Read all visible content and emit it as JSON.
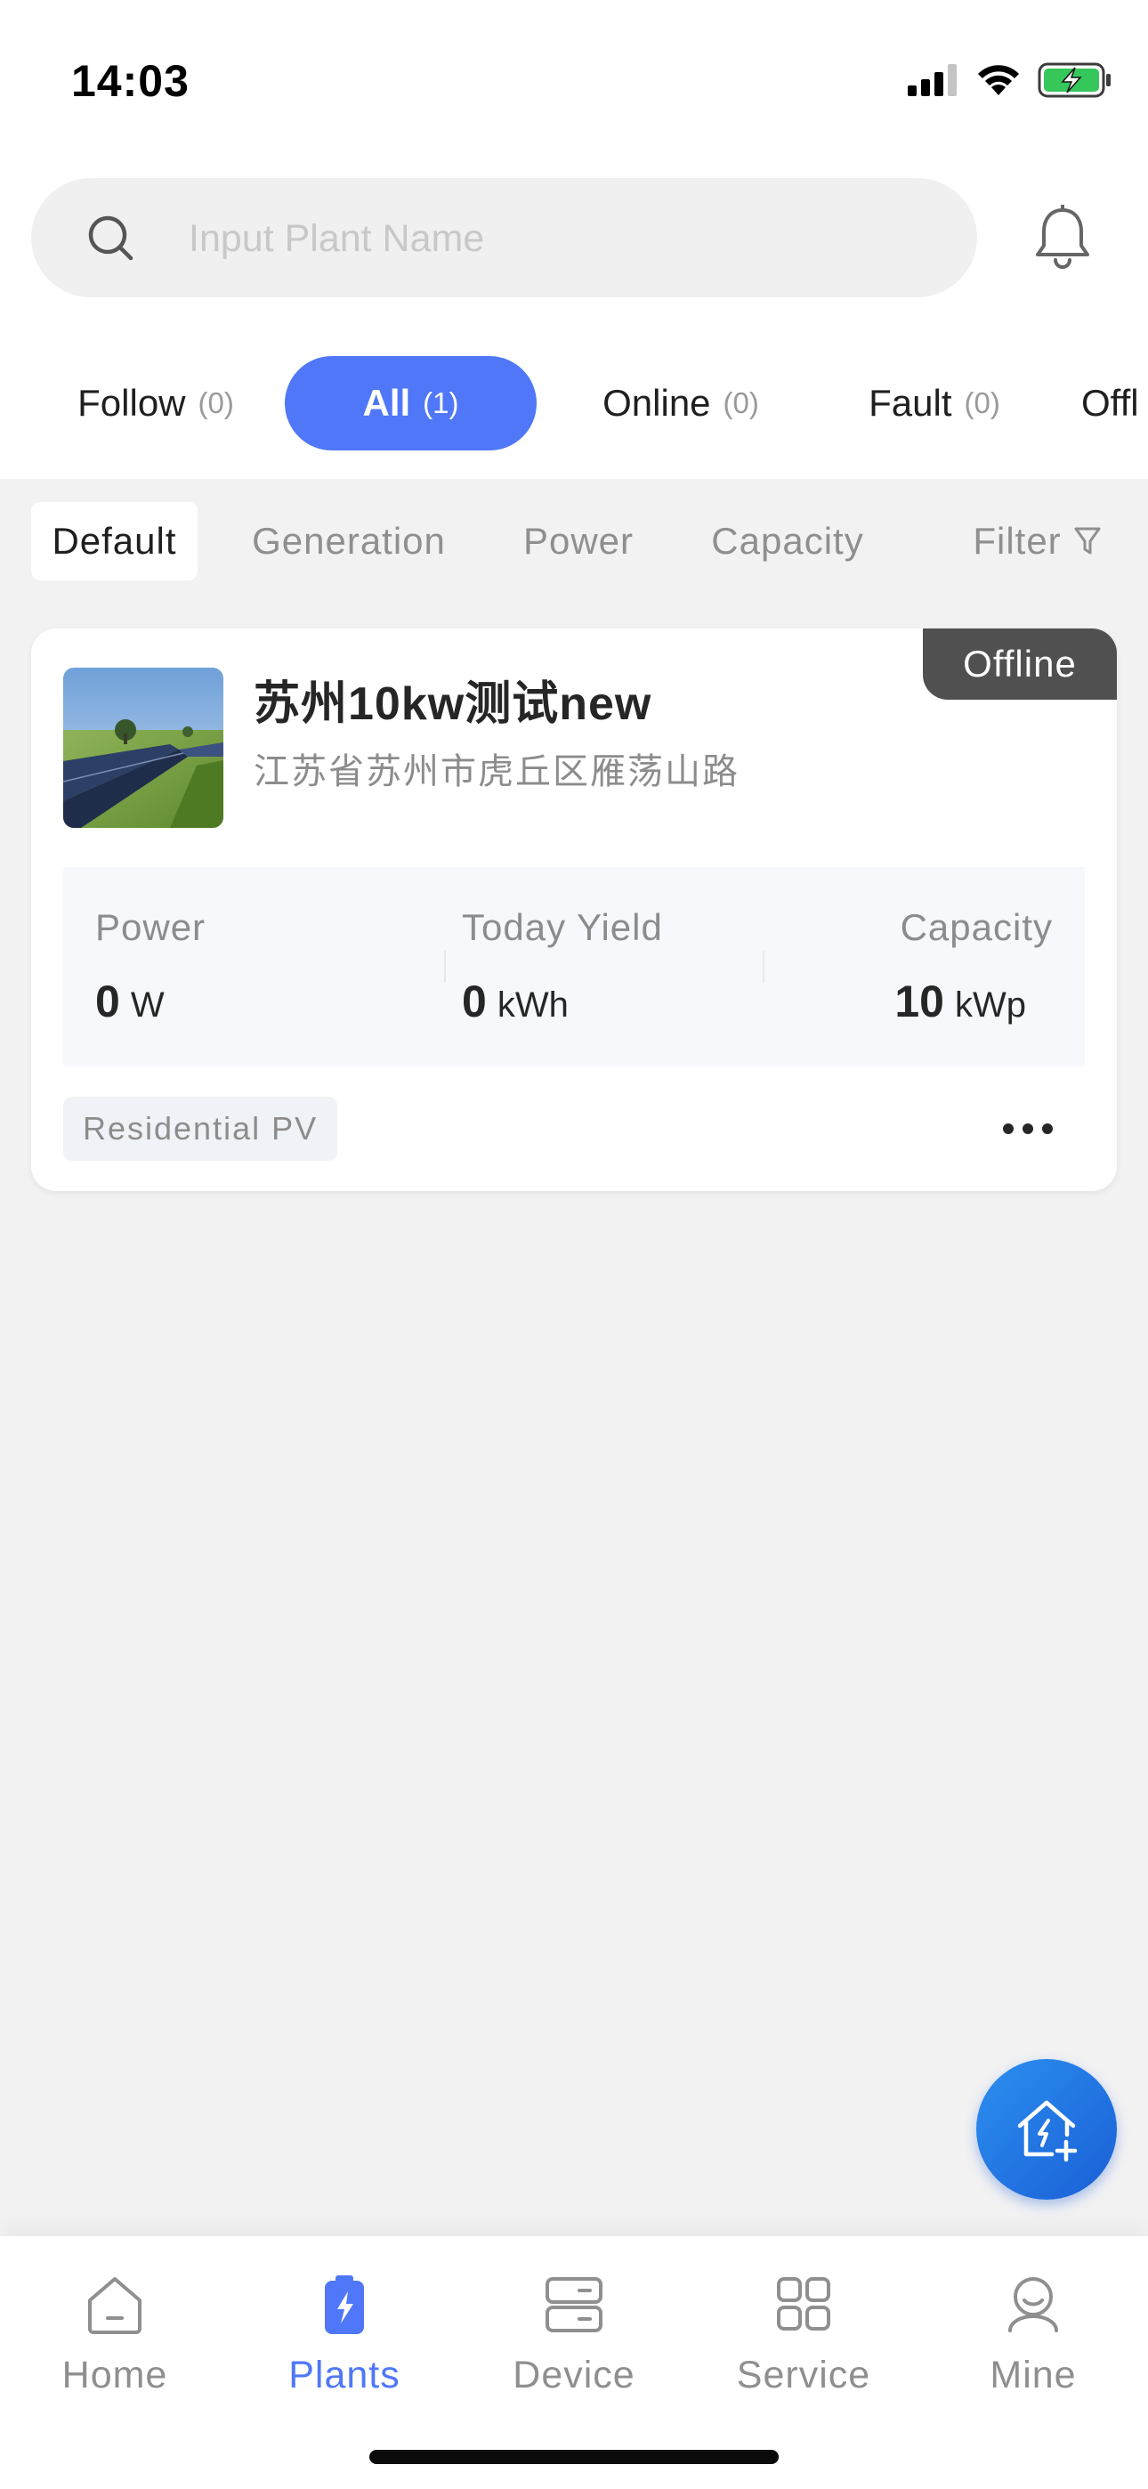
{
  "status_bar": {
    "time": "14:03"
  },
  "search": {
    "placeholder": "Input Plant Name"
  },
  "tabs": [
    {
      "label": "Follow",
      "count": "(0)"
    },
    {
      "label": "All",
      "count": "(1)",
      "active": true
    },
    {
      "label": "Online",
      "count": "(0)"
    },
    {
      "label": "Fault",
      "count": "(0)"
    },
    {
      "label": "Offl"
    }
  ],
  "sort_options": [
    "Default",
    "Generation",
    "Power",
    "Capacity"
  ],
  "sort_active": "Default",
  "filter_label": "Filter",
  "plant": {
    "status": "Offline",
    "name": "苏州10kw测试new",
    "address": "江苏省苏州市虎丘区雁荡山路",
    "stats": [
      {
        "label": "Power",
        "value": "0",
        "unit": "W"
      },
      {
        "label": "Today Yield",
        "value": "0",
        "unit": "kWh"
      },
      {
        "label": "Capacity",
        "value": "10",
        "unit": "kWp"
      }
    ],
    "type": "Residential PV"
  },
  "nav": [
    {
      "label": "Home",
      "icon": "home-icon"
    },
    {
      "label": "Plants",
      "icon": "plants-icon",
      "active": true
    },
    {
      "label": "Device",
      "icon": "device-icon"
    },
    {
      "label": "Service",
      "icon": "service-icon"
    },
    {
      "label": "Mine",
      "icon": "mine-icon"
    }
  ],
  "colors": {
    "accent": "#4f77f7",
    "fab": "#1a5fd6",
    "offline_badge": "#505050"
  }
}
